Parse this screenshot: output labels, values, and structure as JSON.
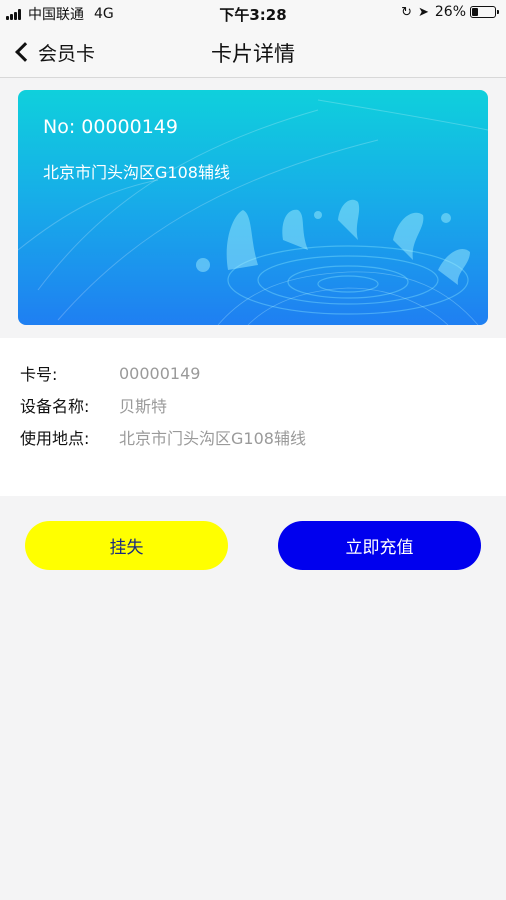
{
  "status_bar": {
    "carrier": "中国联通",
    "network": "4G",
    "time": "下午3:28",
    "battery": "26%",
    "battery_level": 0.26
  },
  "nav": {
    "back_label": "会员卡",
    "title": "卡片详情"
  },
  "card": {
    "number_text": "No: 00000149",
    "location": "北京市门头沟区G108辅线",
    "colors": {
      "top": "#0fd0dc",
      "bottom": "#1f7ff2"
    }
  },
  "details": [
    {
      "label": "卡号:",
      "value": "00000149"
    },
    {
      "label": "设备名称:",
      "value": "贝斯特"
    },
    {
      "label": "使用地点:",
      "value": "北京市门头沟区G108辅线"
    }
  ],
  "actions": {
    "report_loss": "挂失",
    "recharge": "立即充值"
  },
  "colors": {
    "report_button": "#ffff00",
    "recharge_button": "#0000ee",
    "value_text": "#9a9a9a"
  }
}
